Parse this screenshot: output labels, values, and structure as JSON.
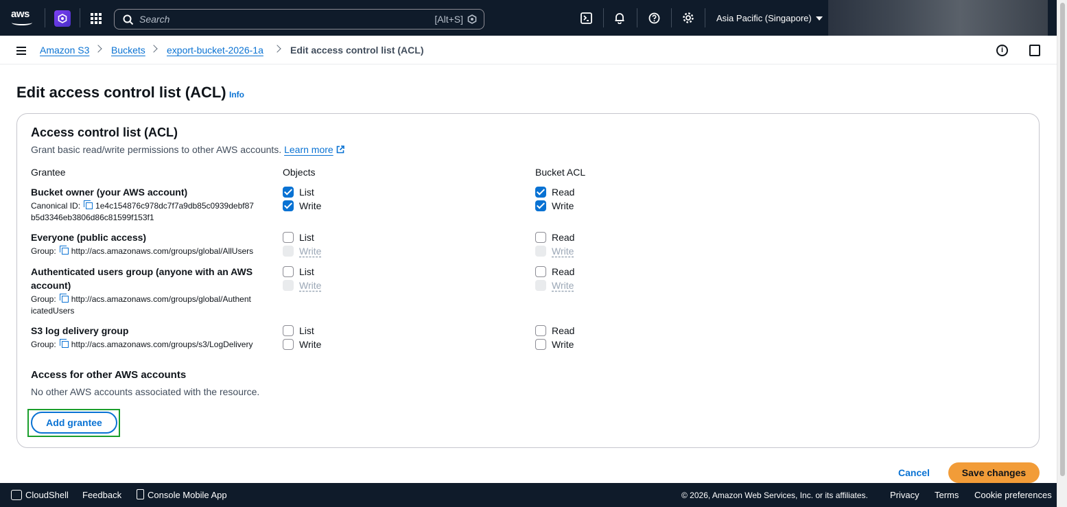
{
  "topnav": {
    "logo_text": "aws",
    "search_placeholder": "Search",
    "search_shortcut": "[Alt+S]",
    "region": "Asia Pacific (Singapore)"
  },
  "breadcrumb": {
    "items": [
      "Amazon S3",
      "Buckets",
      "export-bucket-2026-1a"
    ],
    "current": "Edit access control list (ACL)"
  },
  "page": {
    "title": "Edit access control list (ACL)",
    "info": "Info"
  },
  "acl": {
    "title": "Access control list (ACL)",
    "description": "Grant basic read/write permissions to other AWS accounts.",
    "learn_more": "Learn more",
    "columns": {
      "grantee": "Grantee",
      "objects": "Objects",
      "bucket_acl": "Bucket ACL"
    },
    "grantees": [
      {
        "name": "Bucket owner (your AWS account)",
        "sub_label": "Canonical ID:",
        "sub_value_1": "1e4c154876c978dc7f7a9db85c0939debf87",
        "sub_value_2": "b5d3346eb3806d86c81599f153f1",
        "objects_list": "List",
        "objects_write": "Write",
        "acl_read": "Read",
        "acl_write": "Write"
      },
      {
        "name": "Everyone (public access)",
        "sub_label": "Group:",
        "sub_value_1": "http://acs.amazonaws.com/groups/global/AllUsers",
        "objects_list": "List",
        "objects_write": "Write",
        "acl_read": "Read",
        "acl_write": "Write"
      },
      {
        "name": "Authenticated users group (anyone with an AWS account)",
        "sub_label": "Group:",
        "sub_value_1": "http://acs.amazonaws.com/groups/global/Authent",
        "sub_value_2": "icatedUsers",
        "objects_list": "List",
        "objects_write": "Write",
        "acl_read": "Read",
        "acl_write": "Write"
      },
      {
        "name": "S3 log delivery group",
        "sub_label": "Group:",
        "sub_value_1": "http://acs.amazonaws.com/groups/s3/LogDelivery",
        "objects_list": "List",
        "objects_write": "Write",
        "acl_read": "Read",
        "acl_write": "Write"
      }
    ],
    "other_title": "Access for other AWS accounts",
    "other_desc": "No other AWS accounts associated with the resource.",
    "add_grantee": "Add grantee"
  },
  "actions": {
    "cancel": "Cancel",
    "save": "Save changes"
  },
  "footer": {
    "cloudshell": "CloudShell",
    "feedback": "Feedback",
    "mobile_app": "Console Mobile App",
    "copyright": "© 2026, Amazon Web Services, Inc. or its affiliates.",
    "privacy": "Privacy",
    "terms": "Terms",
    "cookies": "Cookie preferences"
  },
  "colors": {
    "link": "#0972d3",
    "nav_bg": "#0f1b2a",
    "primary_button": "#f29c38",
    "highlight": "#1a9e2b"
  }
}
